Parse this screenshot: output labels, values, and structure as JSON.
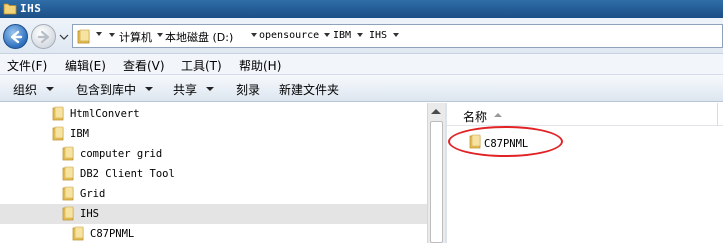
{
  "window": {
    "title": "IHS"
  },
  "address": {
    "crumbs": [
      "计算机",
      "本地磁盘 (D:)",
      "opensource",
      "IBM",
      "IHS"
    ]
  },
  "menu": [
    "文件(F)",
    "编辑(E)",
    "查看(V)",
    "工具(T)",
    "帮助(H)"
  ],
  "toolbar": {
    "organize": "组织",
    "include_in_library": "包含到库中",
    "share": "共享",
    "burn": "刻录",
    "new_folder": "新建文件夹"
  },
  "tree": [
    {
      "label": "HtmlConvert",
      "selected": false
    },
    {
      "label": "IBM",
      "selected": false
    },
    {
      "label": "computer grid",
      "selected": false
    },
    {
      "label": "DB2 Client Tool",
      "selected": false
    },
    {
      "label": "Grid",
      "selected": false
    },
    {
      "label": "IHS",
      "selected": true
    },
    {
      "label": "C87PNML",
      "selected": false
    }
  ],
  "content": {
    "column_name": "名称",
    "items": [
      "C87PNML"
    ]
  },
  "colors": {
    "highlight_ellipse": "#e12326",
    "folder": "#e7c25a",
    "selected_row": "#e4e4e4"
  },
  "icons": [
    "folder-icon",
    "back-arrow-icon",
    "forward-arrow-icon"
  ]
}
